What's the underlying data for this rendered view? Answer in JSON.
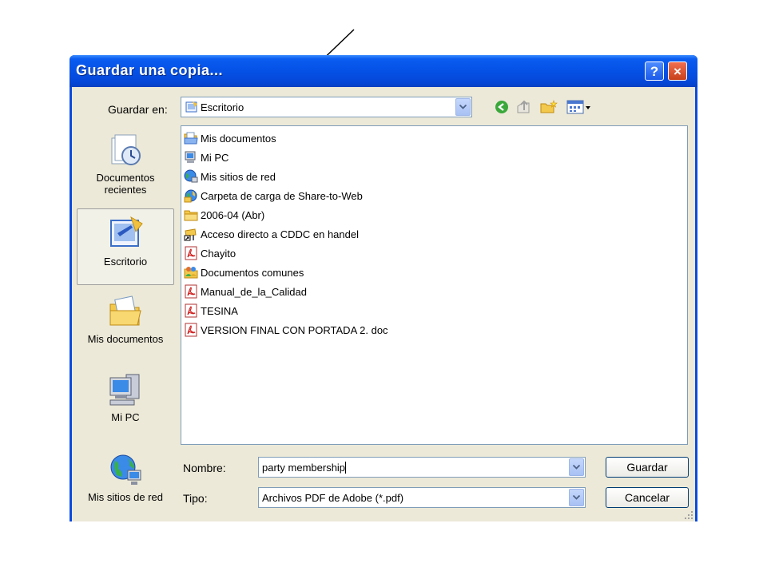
{
  "window": {
    "title": "Guardar una copia...",
    "help_label": "?",
    "close_label": "×"
  },
  "location": {
    "label": "Guardar en:",
    "value": "Escritorio"
  },
  "toolbar": {
    "icons": [
      "back-icon",
      "up-folder-icon",
      "new-folder-icon",
      "view-menu-icon"
    ]
  },
  "places": [
    {
      "label": "Documentos recientes",
      "icon": "recent-documents-icon"
    },
    {
      "label": "Escritorio",
      "icon": "desktop-icon",
      "selected": true
    },
    {
      "label": "Mis documentos",
      "icon": "my-documents-icon"
    },
    {
      "label": "Mi PC",
      "icon": "my-computer-icon"
    },
    {
      "label": "Mis sitios de red",
      "icon": "network-places-icon"
    }
  ],
  "files": [
    {
      "name": "Mis documentos",
      "icon": "my-documents-folder-icon"
    },
    {
      "name": "Mi PC",
      "icon": "my-computer-icon"
    },
    {
      "name": "Mis sitios de red",
      "icon": "network-places-icon"
    },
    {
      "name": "Carpeta de carga de Share-to-Web",
      "icon": "web-folder-icon"
    },
    {
      "name": "2006-04 (Abr)",
      "icon": "folder-icon"
    },
    {
      "name": "Acceso directo a CDDC en handel",
      "icon": "network-shortcut-icon"
    },
    {
      "name": "Chayito",
      "icon": "pdf-file-icon"
    },
    {
      "name": "Documentos comunes",
      "icon": "shared-documents-icon"
    },
    {
      "name": "Manual_de_la_Calidad",
      "icon": "pdf-file-icon"
    },
    {
      "name": "TESINA",
      "icon": "pdf-file-icon"
    },
    {
      "name": "VERSION FINAL CON PORTADA 2. doc",
      "icon": "pdf-file-icon"
    }
  ],
  "filename": {
    "label": "Nombre:",
    "value": "party membership"
  },
  "filetype": {
    "label": "Tipo:",
    "value": "Archivos PDF de Adobe (*.pdf)"
  },
  "buttons": {
    "save": "Guardar",
    "cancel": "Cancelar"
  },
  "colors": {
    "titlebar": "#0551e6",
    "client": "#ece9d8",
    "annotation_arrow": "#000000"
  }
}
